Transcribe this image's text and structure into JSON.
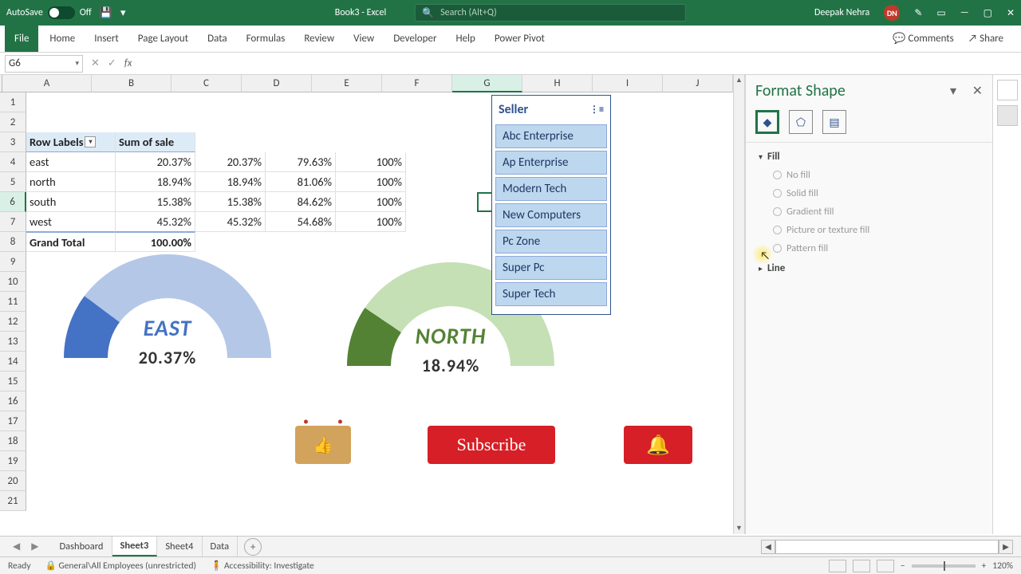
{
  "app": {
    "autosave": "AutoSave",
    "autosave_state": "Off",
    "title": "Book3  -  Excel",
    "search_placeholder": "Search (Alt+Q)",
    "user_name": "Deepak Nehra",
    "user_initials": "DN"
  },
  "ribbon": {
    "tabs": [
      "File",
      "Home",
      "Insert",
      "Page Layout",
      "Data",
      "Formulas",
      "Review",
      "View",
      "Developer",
      "Help",
      "Power Pivot"
    ],
    "comments": "Comments",
    "share": "Share"
  },
  "formula": {
    "name_box": "G6",
    "value": ""
  },
  "columns": [
    "A",
    "B",
    "C",
    "D",
    "E",
    "F",
    "G",
    "H",
    "I",
    "J"
  ],
  "rows": [
    "1",
    "2",
    "3",
    "4",
    "5",
    "6",
    "7",
    "8",
    "9",
    "10",
    "11",
    "12",
    "13",
    "14",
    "15",
    "16",
    "17",
    "18",
    "19",
    "20",
    "21"
  ],
  "selected": {
    "col_index": 6,
    "row_index": 5
  },
  "pivot": {
    "headers": [
      "Row Labels",
      "Sum of sale"
    ],
    "data": [
      {
        "label": "east",
        "b": "20.37%",
        "c": "20.37%",
        "d": "79.63%",
        "e": "100%"
      },
      {
        "label": "north",
        "b": "18.94%",
        "c": "18.94%",
        "d": "81.06%",
        "e": "100%"
      },
      {
        "label": "south",
        "b": "15.38%",
        "c": "15.38%",
        "d": "84.62%",
        "e": "100%"
      },
      {
        "label": "west",
        "b": "45.32%",
        "c": "45.32%",
        "d": "54.68%",
        "e": "100%"
      }
    ],
    "total": {
      "label": "Grand Total",
      "b": "100.00%"
    }
  },
  "slicer": {
    "title": "Seller",
    "items": [
      "Abc Enterprise",
      "Ap Enterprise",
      "Modern Tech",
      "New Computers",
      "Pc Zone",
      "Super Pc",
      "Super Tech"
    ]
  },
  "chart_data": [
    {
      "type": "pie",
      "title": "EAST",
      "values": {
        "filled": 20.37,
        "remaining": 79.63
      },
      "display_pct": "20.37%",
      "colors": {
        "filled": "#4472c4",
        "remaining": "#b4c7e7"
      }
    },
    {
      "type": "pie",
      "title": "NORTH",
      "values": {
        "filled": 18.94,
        "remaining": 81.06
      },
      "display_pct": "18.94%",
      "colors": {
        "filled": "#548235",
        "remaining": "#c5e0b4"
      }
    }
  ],
  "promo": {
    "subscribe": "Subscribe"
  },
  "format_pane": {
    "title": "Format Shape",
    "sections": {
      "fill": "Fill",
      "line": "Line"
    },
    "fill_options": [
      "No fill",
      "Solid fill",
      "Gradient fill",
      "Picture or texture fill",
      "Pattern fill"
    ]
  },
  "sheet_tabs": {
    "tabs": [
      "Dashboard",
      "Sheet3",
      "Sheet4",
      "Data"
    ],
    "active": "Sheet3"
  },
  "status": {
    "ready": "Ready",
    "sensitivity": "General\\All Employees (unrestricted)",
    "accessibility": "Accessibility: Investigate",
    "zoom": "120%"
  }
}
